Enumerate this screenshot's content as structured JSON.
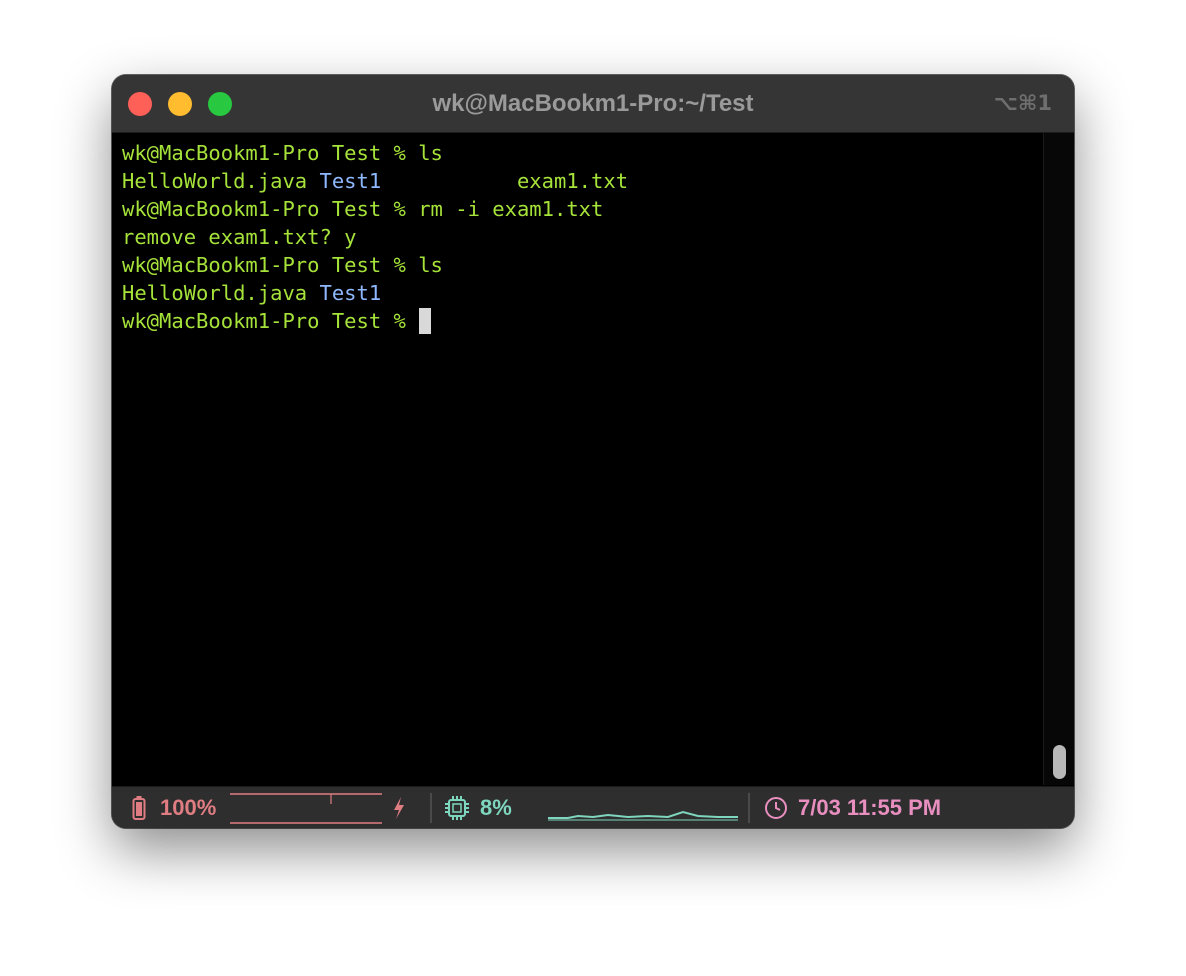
{
  "window": {
    "title": "wk@MacBookm1-Pro:~/Test",
    "shortcut": "⌥⌘1"
  },
  "terminal": {
    "lines": [
      {
        "prompt": "wk@MacBookm1-Pro Test % ",
        "command": "ls"
      },
      {
        "file1": "HelloWorld.java ",
        "dir": "Test1",
        "spacer": "           ",
        "file2": "exam1.txt"
      },
      {
        "prompt": "wk@MacBookm1-Pro Test % ",
        "command": "rm -i exam1.txt"
      },
      {
        "text": "remove exam1.txt? y"
      },
      {
        "prompt": "wk@MacBookm1-Pro Test % ",
        "command": "ls"
      },
      {
        "file1": "HelloWorld.java ",
        "dir": "Test1"
      },
      {
        "prompt": "wk@MacBookm1-Pro Test % "
      }
    ]
  },
  "status_bar": {
    "battery": {
      "value": "100%",
      "icon": "battery-icon",
      "color": "#e07d82",
      "level": 1.0
    },
    "charging_icon": "lightning-icon",
    "cpu": {
      "value": "8%",
      "icon": "cpu-icon",
      "color": "#7fd6be",
      "usage": 0.08
    },
    "clock": {
      "value": "7/03 11:55 PM",
      "icon": "clock-icon",
      "color": "#e88fc0"
    }
  },
  "colors": {
    "prompt_text": "#a6e33a",
    "directory": "#8fb8ff",
    "background": "#000000",
    "titlebar": "#353535"
  }
}
